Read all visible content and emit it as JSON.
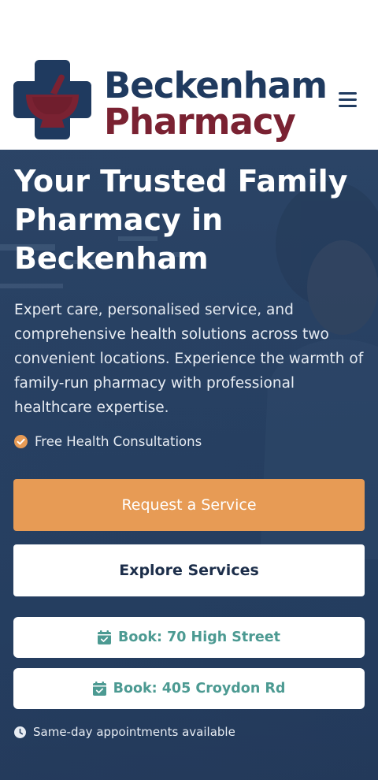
{
  "brand": {
    "name_line1": "Beckenham",
    "name_line2": "Pharmacy",
    "logo_icon": "mortar-and-pestle-cross-icon",
    "colors": {
      "navy": "#1f3a5f",
      "burgundy": "#7a2232"
    }
  },
  "header": {
    "menu_icon": "hamburger-menu-icon"
  },
  "hero": {
    "title": "Your Trusted Family Pharmacy in Beckenham",
    "description": "Expert care, personalised service, and comprehensive health solutions across two convenient locations. Experience the warmth of family-run pharmacy with professional healthcare expertise.",
    "feature": {
      "icon": "check-circle-icon",
      "text": "Free Health Consultations"
    },
    "buttons": {
      "primary": "Request a Service",
      "secondary": "Explore Services",
      "book_1": "Book: 70 High Street",
      "book_2": "Book: 405 Croydon Rd"
    },
    "note": {
      "icon": "clock-icon",
      "text": "Same-day appointments available"
    },
    "colors": {
      "accent": "#e79b55",
      "teal": "#4c9a92",
      "overlay": "#263f61"
    }
  }
}
